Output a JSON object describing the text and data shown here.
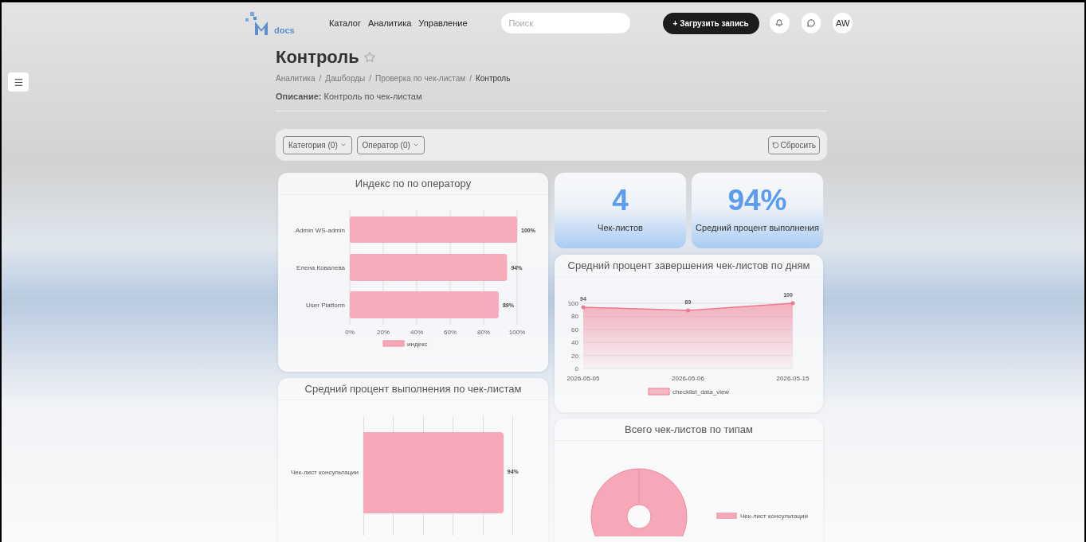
{
  "logo": {
    "text": "docs"
  },
  "nav": {
    "items": [
      {
        "label": "Каталог"
      },
      {
        "label": "Аналитика"
      },
      {
        "label": "Управление"
      }
    ]
  },
  "search": {
    "placeholder": "Поиск"
  },
  "upload_button": {
    "label": "+ Загрузить запись"
  },
  "avatar": {
    "initials": "AW"
  },
  "page": {
    "title": "Контроль",
    "favorite": false,
    "breadcrumbs": [
      {
        "label": "Аналитика",
        "current": false
      },
      {
        "label": "Дашборды",
        "current": false
      },
      {
        "label": "Проверка по чек-листам",
        "current": false
      },
      {
        "label": "Контроль",
        "current": true
      }
    ],
    "separator": "/",
    "description_label": "Описание:",
    "description": "Контроль по чек-листам"
  },
  "filters": {
    "items": [
      {
        "label": "Категория (0)"
      },
      {
        "label": "Оператор (0)"
      }
    ],
    "reset": "Сбросить"
  },
  "kpis": [
    {
      "value": "4",
      "label": "Чек-листов"
    },
    {
      "value": "94%",
      "label": "Средний процент выполнения"
    }
  ],
  "operator_chart": {
    "title": "Индекс по по оператору",
    "chart_data": {
      "type": "bar",
      "orientation": "horizontal",
      "categories": [
        "Admin WS-admin",
        "Елена Ковалева",
        "User Platform"
      ],
      "series": [
        {
          "name": "индекс",
          "color": "#f7a8b8",
          "values": [
            100,
            94,
            89
          ]
        }
      ],
      "xlim": [
        0,
        100
      ],
      "grid": true,
      "xticks": [
        {
          "value": 0,
          "label": "0%"
        },
        {
          "value": 20,
          "label": "20%"
        },
        {
          "value": 40,
          "label": "40%"
        },
        {
          "value": 60,
          "label": "60%"
        },
        {
          "value": 80,
          "label": "80%"
        },
        {
          "value": 100,
          "label": "100%"
        }
      ],
      "value_labels": [
        "100%",
        "94%",
        "89%"
      ]
    }
  },
  "daily_chart": {
    "title": "Средний процент завершения чек-листов по дням",
    "chart_data": {
      "type": "line",
      "x": [
        "2026-05-05",
        "2026-05-06",
        "2026-05-15"
      ],
      "series": [
        {
          "name": "checklist_data_view",
          "color": "#f07890",
          "values": [
            94,
            89,
            100
          ]
        }
      ],
      "ylim": [
        0,
        100
      ],
      "grid": true,
      "yticks": [
        0,
        20,
        40,
        60,
        80,
        100
      ],
      "value_labels": [
        "94",
        "89",
        "100"
      ]
    }
  },
  "checklist_chart": {
    "title": "Средний процент выполнения по чек-листам",
    "category": "Чек-лист консультации",
    "value_label": "94%",
    "level": 0.94
  },
  "types_chart": {
    "title": "Всего чек-листов по типам",
    "legend": [
      {
        "label": "Чек-лист консультации",
        "color": "#f7a8b8"
      }
    ]
  }
}
